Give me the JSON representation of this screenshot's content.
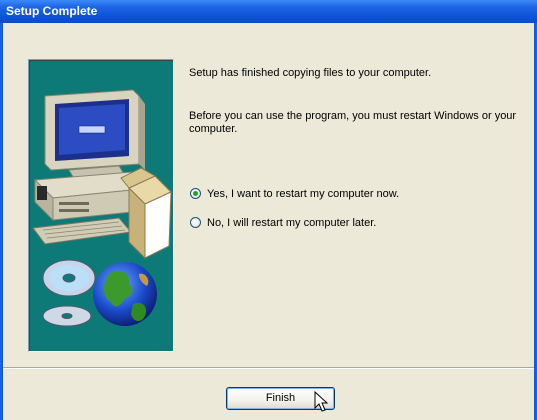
{
  "window": {
    "title": "Setup Complete"
  },
  "message": {
    "line1": "Setup has finished copying files to your computer.",
    "line2": "Before you can use the program, you must restart Windows or your computer."
  },
  "options": [
    {
      "label": "Yes, I want to restart my computer now.",
      "selected": true
    },
    {
      "label": "No, I will restart my computer later.",
      "selected": false
    }
  ],
  "buttons": {
    "finish_label": "Finish"
  },
  "colors": {
    "titlebar": "#0C55D8",
    "dialog_bg": "#ECE9D8",
    "art_bg": "#0E7A78",
    "radio_dot": "#21A121"
  },
  "icons": [
    "computer-illustration",
    "cd-disc-icon",
    "globe-icon",
    "mouse-cursor-icon"
  ]
}
